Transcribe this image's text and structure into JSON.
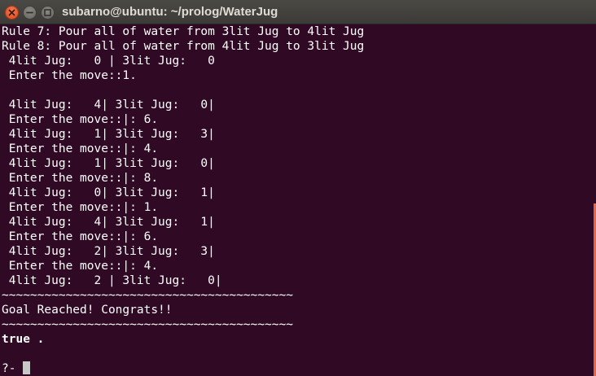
{
  "window": {
    "title": "subarno@ubuntu: ~/prolog/WaterJug"
  },
  "colors": {
    "terminal_background": "#300a24",
    "terminal_text": "#ffffff",
    "titlebar": "#3c3b37",
    "close_button": "#e25a2c",
    "scrollbar": "#e0674a"
  },
  "terminal": {
    "lines": [
      "Rule 7: Pour all of water from 3lit Jug to 4lit Jug",
      "Rule 8: Pour all of water from 4lit Jug to 3lit Jug",
      " 4lit Jug:   0 | 3lit Jug:   0",
      " Enter the move::1.",
      "",
      " 4lit Jug:   4| 3lit Jug:   0|",
      " Enter the move::|: 6.",
      " 4lit Jug:   1| 3lit Jug:   3|",
      " Enter the move::|: 4.",
      " 4lit Jug:   1| 3lit Jug:   0|",
      " Enter the move::|: 8.",
      " 4lit Jug:   0| 3lit Jug:   1|",
      " Enter the move::|: 1.",
      " 4lit Jug:   4| 3lit Jug:   1|",
      " Enter the move::|: 6.",
      " 4lit Jug:   2| 3lit Jug:   3|",
      " Enter the move::|: 4.",
      " 4lit Jug:   2 | 3lit Jug:   0|",
      "~~~~~~~~~~~~~~~~~~~~~~~~~~~~~~~~~~~~~~~~~",
      "Goal Reached! Congrats!!",
      "~~~~~~~~~~~~~~~~~~~~~~~~~~~~~~~~~~~~~~~~~",
      "true .",
      "",
      "?- "
    ]
  }
}
